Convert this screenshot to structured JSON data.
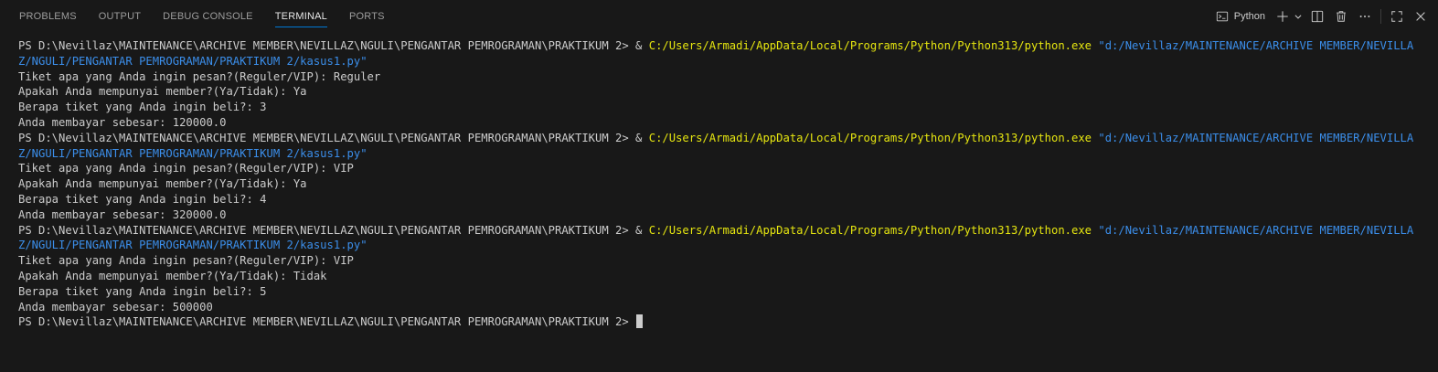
{
  "tabs": [
    {
      "label": "PROBLEMS",
      "active": false
    },
    {
      "label": "OUTPUT",
      "active": false
    },
    {
      "label": "DEBUG CONSOLE",
      "active": false
    },
    {
      "label": "TERMINAL",
      "active": true
    },
    {
      "label": "PORTS",
      "active": false
    }
  ],
  "toolbar": {
    "profile_label": "Python",
    "icons": [
      "terminal-icon",
      "plus-icon",
      "chevron-down-icon",
      "split-terminal-icon",
      "trash-icon",
      "more-icon",
      "maximize-icon",
      "close-icon"
    ]
  },
  "colors": {
    "accent": "#0078d4",
    "exe_path": "#e5e510",
    "string": "#3b8eea",
    "background": "#181818"
  },
  "terminal": {
    "runs": [
      {
        "prompt": "PS D:\\Nevillaz\\MAINTENANCE\\ARCHIVE MEMBER\\NEVILLAZ\\NGULI\\PENGANTAR PEMROGRAMAN\\PRAKTIKUM 2> & ",
        "exe": "C:/Users/Armadi/AppData/Local/Programs/Python/Python313/python.exe",
        "arg": "\"d:/Nevillaz/MAINTENANCE/ARCHIVE MEMBER/NEVILLAZ/NGULI/PENGANTAR PEMROGRAMAN/PRAKTIKUM 2/kasus1.py\"",
        "output": [
          "Tiket apa yang Anda ingin pesan?(Reguler/VIP): Reguler",
          "Apakah Anda mempunyai member?(Ya/Tidak): Ya",
          "Berapa tiket yang Anda ingin beli?: 3",
          "Anda membayar sebesar: 120000.0"
        ]
      },
      {
        "prompt": "PS D:\\Nevillaz\\MAINTENANCE\\ARCHIVE MEMBER\\NEVILLAZ\\NGULI\\PENGANTAR PEMROGRAMAN\\PRAKTIKUM 2> & ",
        "exe": "C:/Users/Armadi/AppData/Local/Programs/Python/Python313/python.exe",
        "arg": "\"d:/Nevillaz/MAINTENANCE/ARCHIVE MEMBER/NEVILLAZ/NGULI/PENGANTAR PEMROGRAMAN/PRAKTIKUM 2/kasus1.py\"",
        "output": [
          "Tiket apa yang Anda ingin pesan?(Reguler/VIP): VIP",
          "Apakah Anda mempunyai member?(Ya/Tidak): Ya",
          "Berapa tiket yang Anda ingin beli?: 4",
          "Anda membayar sebesar: 320000.0"
        ]
      },
      {
        "prompt": "PS D:\\Nevillaz\\MAINTENANCE\\ARCHIVE MEMBER\\NEVILLAZ\\NGULI\\PENGANTAR PEMROGRAMAN\\PRAKTIKUM 2> & ",
        "exe": "C:/Users/Armadi/AppData/Local/Programs/Python/Python313/python.exe",
        "arg": "\"d:/Nevillaz/MAINTENANCE/ARCHIVE MEMBER/NEVILLAZ/NGULI/PENGANTAR PEMROGRAMAN/PRAKTIKUM 2/kasus1.py\"",
        "output": [
          "Tiket apa yang Anda ingin pesan?(Reguler/VIP): VIP",
          "Apakah Anda mempunyai member?(Ya/Tidak): Tidak",
          "Berapa tiket yang Anda ingin beli?: 5",
          "Anda membayar sebesar: 500000"
        ]
      }
    ],
    "final_prompt": "PS D:\\Nevillaz\\MAINTENANCE\\ARCHIVE MEMBER\\NEVILLAZ\\NGULI\\PENGANTAR PEMROGRAMAN\\PRAKTIKUM 2> "
  }
}
